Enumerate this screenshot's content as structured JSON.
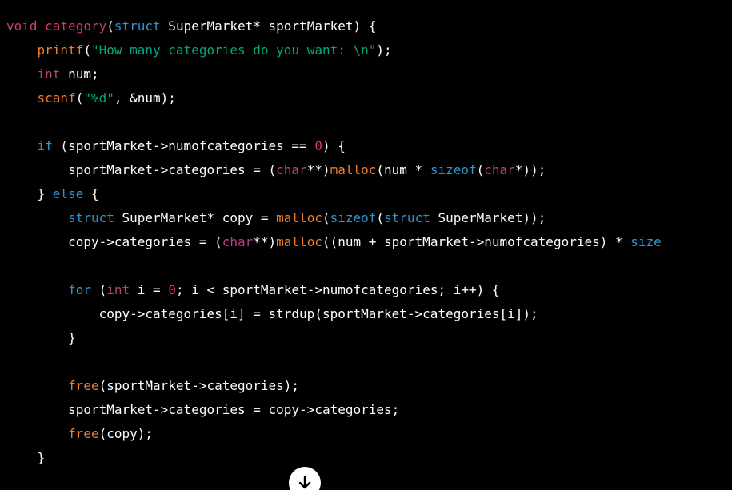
{
  "colors": {
    "background": "#000000",
    "keyword": "#c04080",
    "type": "#2e95d3",
    "function": "#f27b2e",
    "string": "#00a67d",
    "number": "#df3079",
    "text": "#ffffff"
  },
  "code_lines": [
    [
      {
        "t": "kw",
        "v": "void"
      },
      {
        "t": "plain",
        "v": " "
      },
      {
        "t": "num",
        "v": "category"
      },
      {
        "t": "plain",
        "v": "("
      },
      {
        "t": "type",
        "v": "struct"
      },
      {
        "t": "plain",
        "v": " SuperMarket* sportMarket) {"
      }
    ],
    [
      {
        "t": "plain",
        "v": "    "
      },
      {
        "t": "fn",
        "v": "printf"
      },
      {
        "t": "plain",
        "v": "("
      },
      {
        "t": "str",
        "v": "\"How many categories do you want: \\n\""
      },
      {
        "t": "plain",
        "v": ");"
      }
    ],
    [
      {
        "t": "plain",
        "v": "    "
      },
      {
        "t": "kw",
        "v": "int"
      },
      {
        "t": "plain",
        "v": " num;"
      }
    ],
    [
      {
        "t": "plain",
        "v": "    "
      },
      {
        "t": "fn",
        "v": "scanf"
      },
      {
        "t": "plain",
        "v": "("
      },
      {
        "t": "str",
        "v": "\"%d\""
      },
      {
        "t": "plain",
        "v": ", &num);"
      }
    ],
    [],
    [
      {
        "t": "plain",
        "v": "    "
      },
      {
        "t": "type",
        "v": "if"
      },
      {
        "t": "plain",
        "v": " (sportMarket->numofcategories == "
      },
      {
        "t": "num",
        "v": "0"
      },
      {
        "t": "plain",
        "v": ") {"
      }
    ],
    [
      {
        "t": "plain",
        "v": "        sportMarket->categories = ("
      },
      {
        "t": "kw",
        "v": "char"
      },
      {
        "t": "plain",
        "v": "**)"
      },
      {
        "t": "fn",
        "v": "malloc"
      },
      {
        "t": "plain",
        "v": "(num * "
      },
      {
        "t": "type",
        "v": "sizeof"
      },
      {
        "t": "plain",
        "v": "("
      },
      {
        "t": "kw",
        "v": "char"
      },
      {
        "t": "plain",
        "v": "*));"
      }
    ],
    [
      {
        "t": "plain",
        "v": "    } "
      },
      {
        "t": "type",
        "v": "else"
      },
      {
        "t": "plain",
        "v": " {"
      }
    ],
    [
      {
        "t": "plain",
        "v": "        "
      },
      {
        "t": "type",
        "v": "struct"
      },
      {
        "t": "plain",
        "v": " SuperMarket* copy = "
      },
      {
        "t": "fn",
        "v": "malloc"
      },
      {
        "t": "plain",
        "v": "("
      },
      {
        "t": "type",
        "v": "sizeof"
      },
      {
        "t": "plain",
        "v": "("
      },
      {
        "t": "type",
        "v": "struct"
      },
      {
        "t": "plain",
        "v": " SuperMarket));"
      }
    ],
    [
      {
        "t": "plain",
        "v": "        copy->categories = ("
      },
      {
        "t": "kw",
        "v": "char"
      },
      {
        "t": "plain",
        "v": "**)"
      },
      {
        "t": "fn",
        "v": "malloc"
      },
      {
        "t": "plain",
        "v": "((num + sportMarket->numofcategories) * "
      },
      {
        "t": "type",
        "v": "size"
      }
    ],
    [],
    [
      {
        "t": "plain",
        "v": "        "
      },
      {
        "t": "type",
        "v": "for"
      },
      {
        "t": "plain",
        "v": " ("
      },
      {
        "t": "kw",
        "v": "int"
      },
      {
        "t": "plain",
        "v": " i = "
      },
      {
        "t": "num",
        "v": "0"
      },
      {
        "t": "plain",
        "v": "; i < sportMarket->numofcategories; i++) {"
      }
    ],
    [
      {
        "t": "plain",
        "v": "            copy->categories[i] = strdup(sportMarket->categories[i]);"
      }
    ],
    [
      {
        "t": "plain",
        "v": "        }"
      }
    ],
    [],
    [
      {
        "t": "plain",
        "v": "        "
      },
      {
        "t": "fn",
        "v": "free"
      },
      {
        "t": "plain",
        "v": "(sportMarket->categories);"
      }
    ],
    [
      {
        "t": "plain",
        "v": "        sportMarket->categories = copy->categories;"
      }
    ],
    [
      {
        "t": "plain",
        "v": "        "
      },
      {
        "t": "fn",
        "v": "free"
      },
      {
        "t": "plain",
        "v": "(copy);"
      }
    ],
    [
      {
        "t": "plain",
        "v": "    }"
      }
    ]
  ],
  "scroll_button": {
    "icon": "arrow-down-icon"
  }
}
